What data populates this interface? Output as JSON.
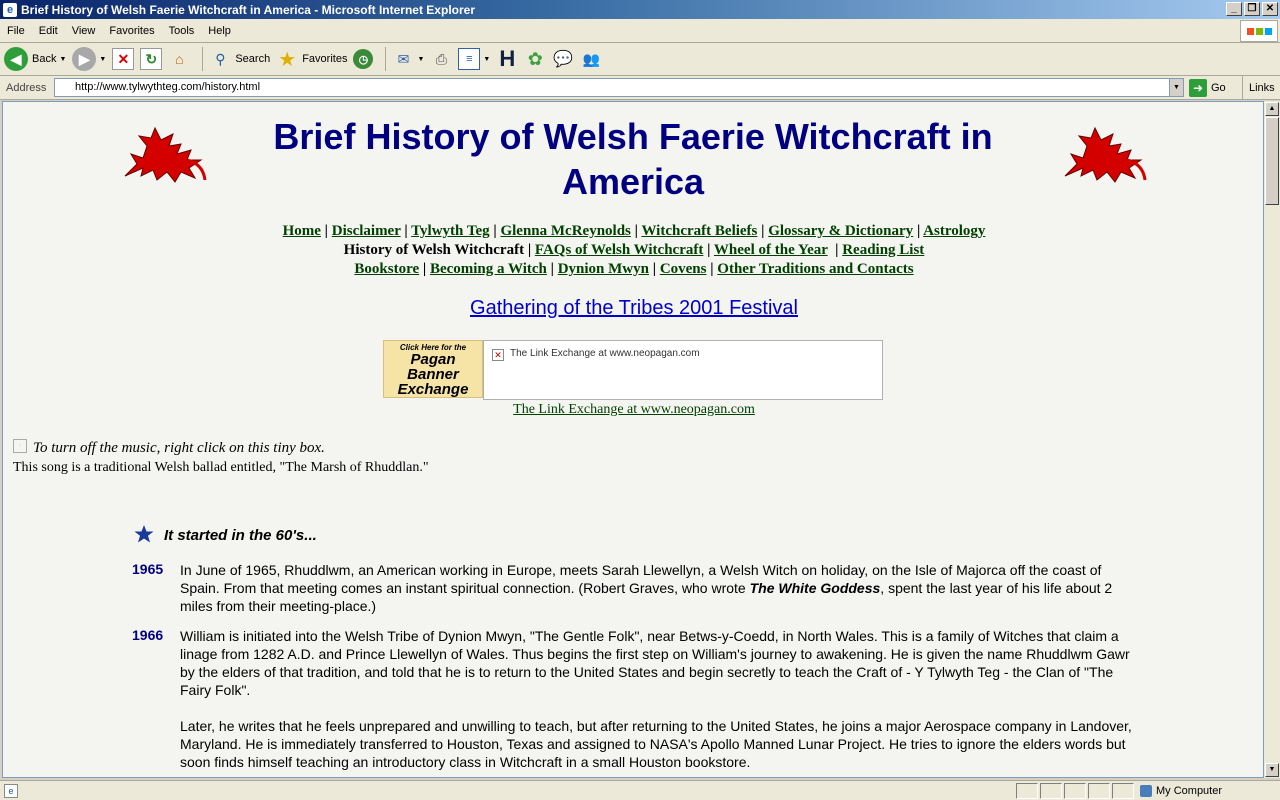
{
  "window": {
    "title": "Brief History of Welsh Faerie Witchcraft in America - Microsoft Internet Explorer"
  },
  "menu": [
    "File",
    "Edit",
    "View",
    "Favorites",
    "Tools",
    "Help"
  ],
  "toolbar": {
    "back": "Back",
    "search": "Search",
    "favorites": "Favorites"
  },
  "address": {
    "label": "Address",
    "url": "http://www.tylwythteg.com/history.html",
    "go": "Go",
    "links": "Links"
  },
  "status": {
    "zone": "My Computer"
  },
  "page": {
    "title": "Brief History of Welsh Faerie Witchcraft in America",
    "nav": {
      "home": "Home",
      "disclaimer": "Disclaimer",
      "tylwyth": "Tylwyth Teg",
      "glenna": "Glenna McReynolds",
      "beliefs": "Witchcraft Beliefs",
      "glossary": "Glossary & Dictionary",
      "astrology": "Astrology",
      "history": "History of Welsh Witchcraft",
      "faqs": "FAQs of Welsh Witchcraft",
      "wheel": "Wheel of the Year",
      "reading": "Reading List",
      "bookstore": "Bookstore",
      "becoming": "Becoming a Witch",
      "dynion": "Dynion Mwyn",
      "covens": "Covens",
      "other": "Other Traditions and Contacts"
    },
    "festival": "Gathering of the Tribes 2001 Festival",
    "banner": {
      "l1": "Click Here for the",
      "l2": "Pagan",
      "l3": "Banner",
      "l4": "Exchange"
    },
    "exchange_alt": "The Link Exchange at www.neopagan.com",
    "exchange_link": "The Link Exchange at www.neopagan.com",
    "music_note": "To turn off the music, right click on this tiny box.",
    "song_note": "This song is a traditional Welsh ballad entitled, \"The Marsh of Rhuddlan.\"",
    "subhead": "It started in the 60's...",
    "entries": [
      {
        "year": "1965",
        "text_a": "In June of 1965, Rhuddlwm, an American working in Europe, meets Sarah Llewellyn, a Welsh Witch on holiday, on the Isle of Majorca off the coast of Spain. From that meeting comes an instant spiritual connection. (Robert Graves, who wrote ",
        "book": "The White Goddess",
        "text_b": ", spent the last year of his life about 2 miles from their meeting-place.)"
      },
      {
        "year": "1966",
        "text": "William is initiated into the Welsh Tribe of Dynion Mwyn, \"The Gentle Folk\", near Betws-y-Coedd, in North Wales. This is a family of Witches that claim a linage from 1282 A.D. and Prince Llewellyn of Wales. Thus begins the first step on William's journey to awakening. He is given the name Rhuddlwm Gawr by the elders of that tradition, and told that he is to return to the United States and begin secretly to teach the Craft of - Y Tylwyth Teg - the Clan of \"The Fairy Folk\".",
        "text2": "Later, he writes that he feels unprepared and unwilling to teach, but after returning to the United States, he joins a major Aerospace company in Landover, Maryland. He is immediately transferred to Houston, Texas and assigned to NASA's Apollo Manned Lunar Project. He tries to ignore the elders words but soon finds himself teaching an introductory class in Witchcraft in a small Houston bookstore."
      }
    ]
  }
}
